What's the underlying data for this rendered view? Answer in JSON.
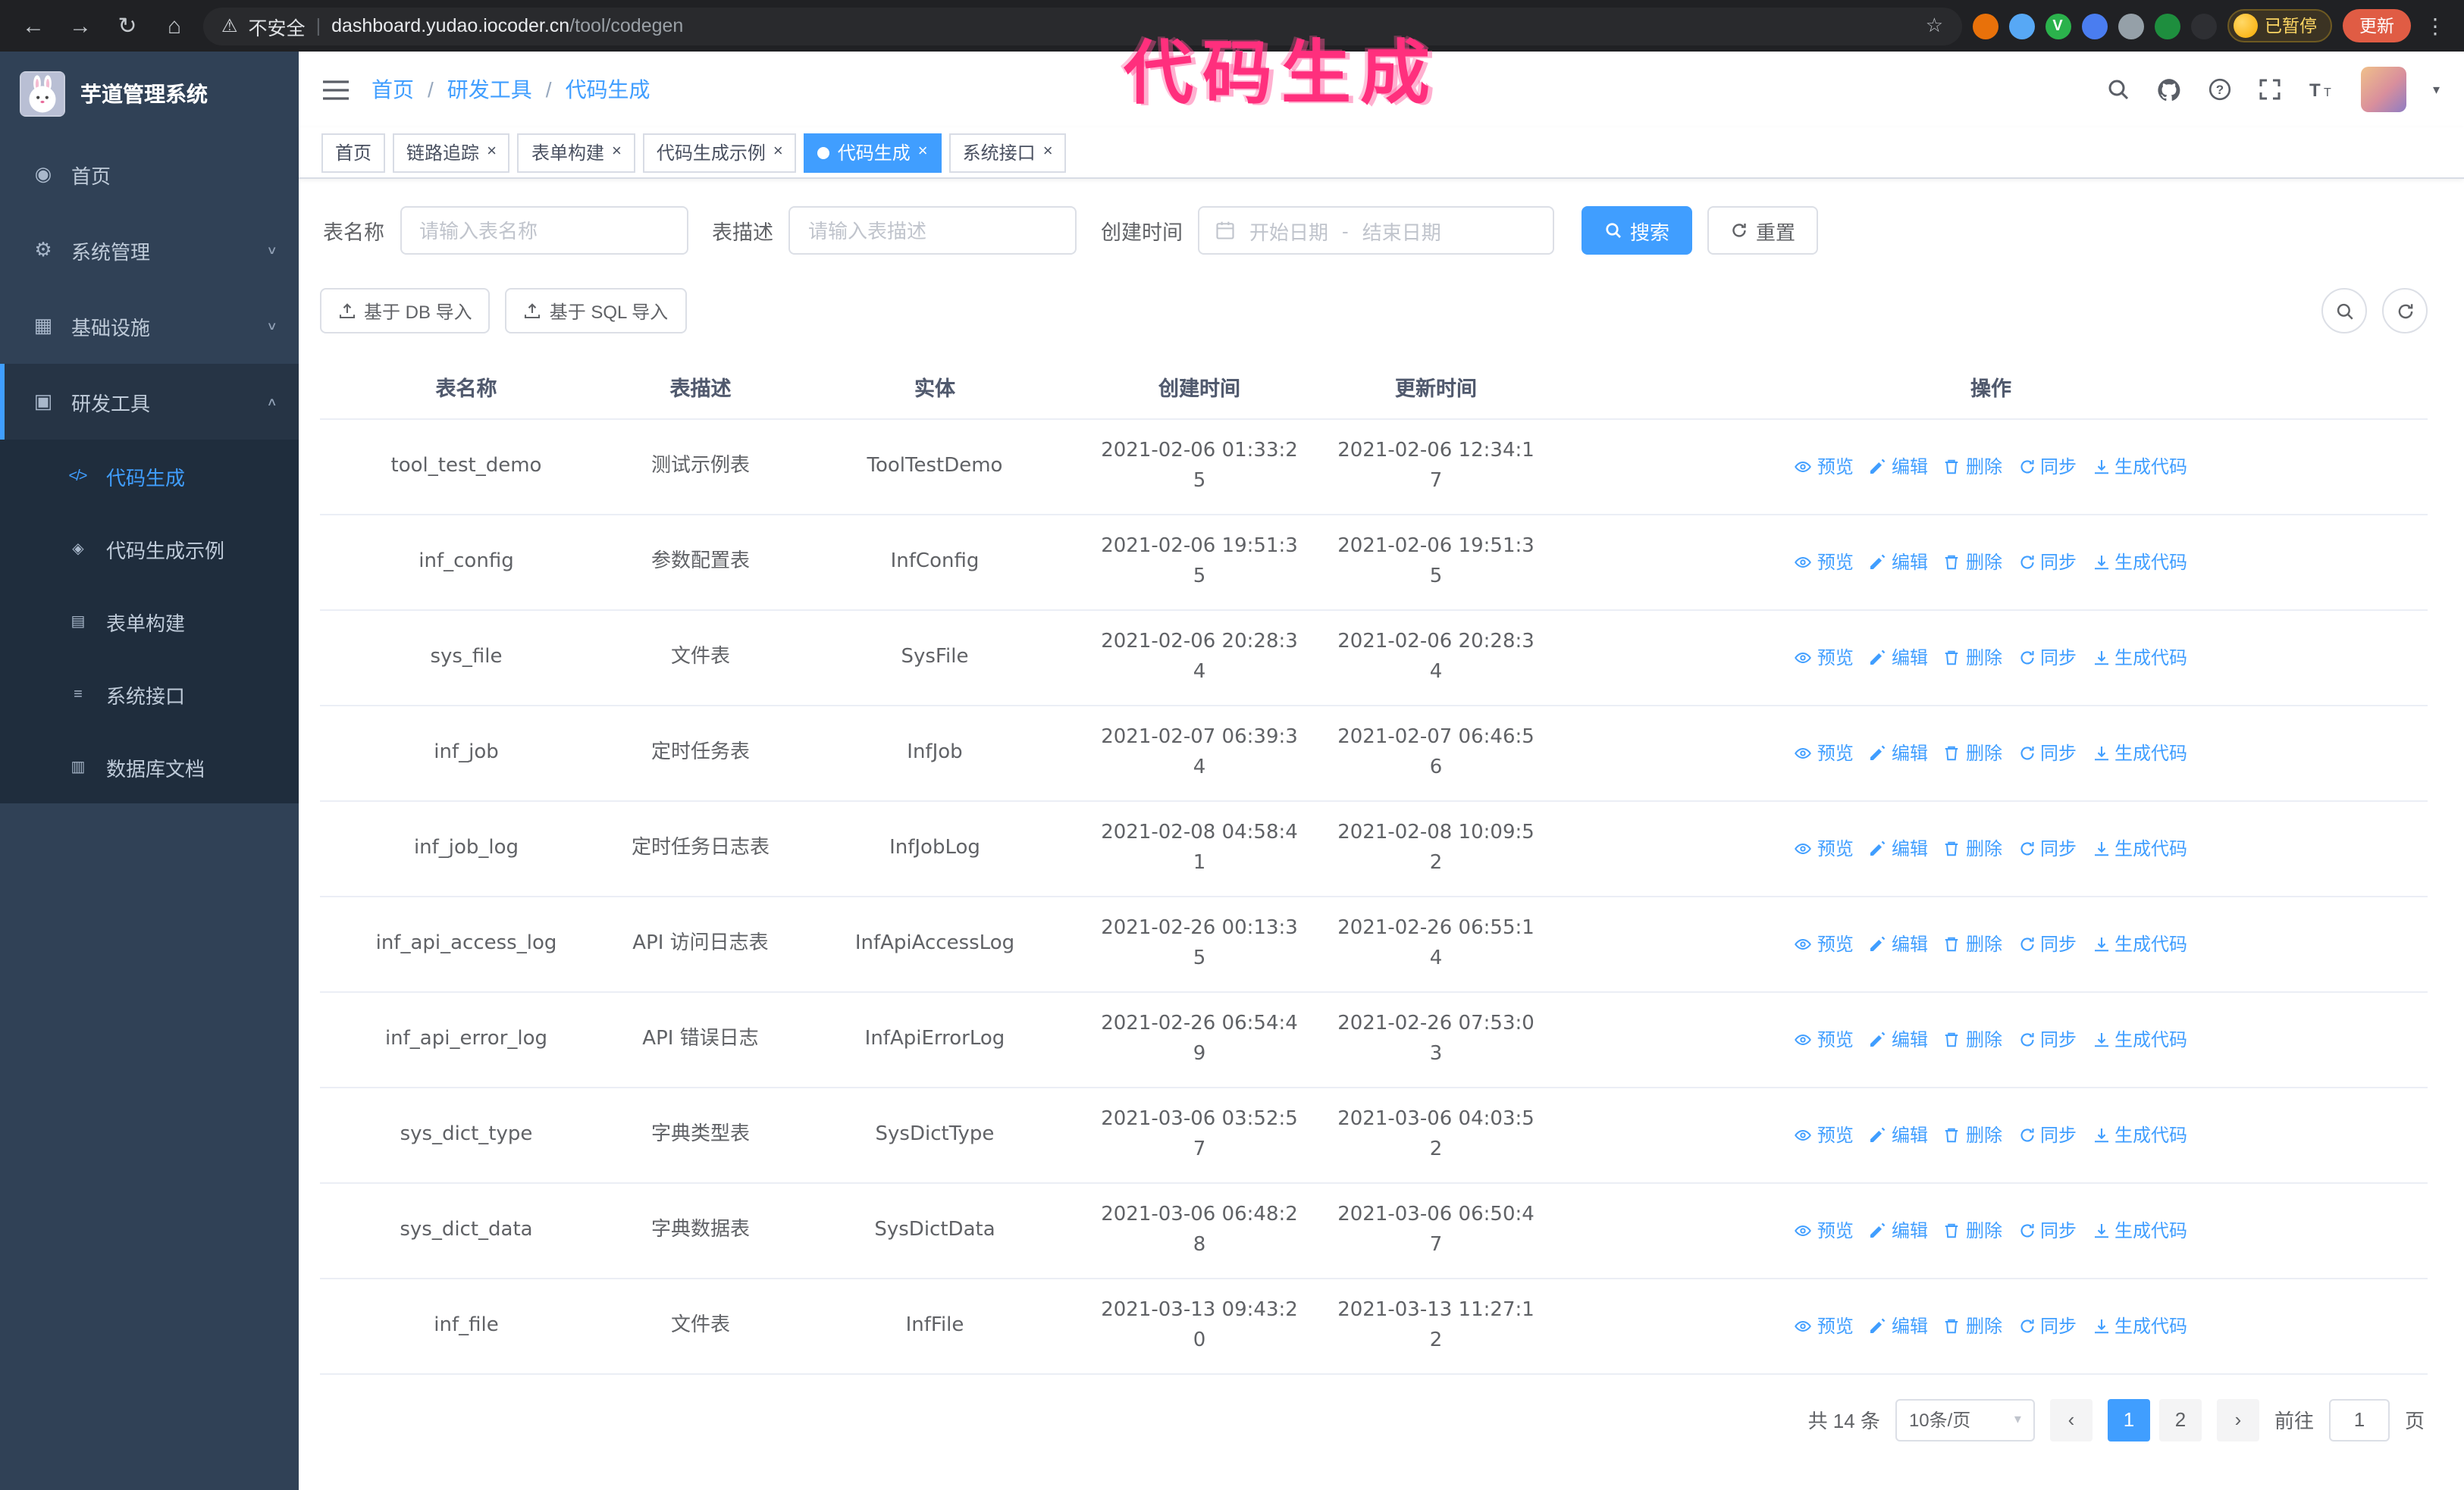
{
  "annotation": {
    "text": "代码生成"
  },
  "glyphs": {
    "back": "←",
    "forward": "→",
    "reload": "↻",
    "home": "⌂",
    "warning": "⚠",
    "divider": "|",
    "star": "☆",
    "kebab": "⋮",
    "close": "×",
    "caret_down": "▾",
    "crumb_sep": "/",
    "page_prev": "‹",
    "page_next": "›"
  },
  "browser": {
    "insecure_label": "不安全",
    "url_host": "dashboard.yudao.iocoder.cn",
    "url_path": "/tool/codegen",
    "extensions": [
      {
        "color": "#e8710a",
        "glyph": ""
      },
      {
        "color": "#57a8f5",
        "glyph": ""
      },
      {
        "color": "#2bb24c",
        "glyph": "V"
      },
      {
        "color": "#4a7df0",
        "glyph": ""
      },
      {
        "color": "#95a0a8",
        "glyph": ""
      },
      {
        "color": "#1e8e3e",
        "glyph": ""
      },
      {
        "color": "#2e2f33",
        "glyph": ""
      }
    ],
    "paused_badge": "已暂停",
    "update_button": "更新"
  },
  "sidebar": {
    "logo_title": "芋道管理系统",
    "items": [
      {
        "label": "首页",
        "glyph": "◉",
        "icon": "dashboard-icon",
        "chev": "",
        "open": false
      },
      {
        "label": "系统管理",
        "glyph": "⚙",
        "icon": "gear-icon",
        "chev": "∨",
        "open": false
      },
      {
        "label": "基础设施",
        "glyph": "▦",
        "icon": "infrastructure-icon",
        "chev": "∨",
        "open": false
      },
      {
        "label": "研发工具",
        "glyph": "▣",
        "icon": "dev-tools-icon",
        "chev": "∧",
        "open": true
      }
    ],
    "submenu": [
      {
        "label": "代码生成",
        "glyph": "</>",
        "icon": "code-icon",
        "active": true
      },
      {
        "label": "代码生成示例",
        "glyph": "◈",
        "icon": "code-example-icon",
        "active": false
      },
      {
        "label": "表单构建",
        "glyph": "▤",
        "icon": "form-builder-icon",
        "active": false
      },
      {
        "label": "系统接口",
        "glyph": "≡",
        "icon": "api-icon",
        "active": false
      },
      {
        "label": "数据库文档",
        "glyph": "▥",
        "icon": "database-doc-icon",
        "active": false
      }
    ]
  },
  "header": {
    "breadcrumb": [
      "首页",
      "研发工具",
      "代码生成"
    ]
  },
  "tabs": [
    {
      "label": "首页",
      "closable": false,
      "active": false
    },
    {
      "label": "链路追踪",
      "closable": true,
      "active": false
    },
    {
      "label": "表单构建",
      "closable": true,
      "active": false
    },
    {
      "label": "代码生成示例",
      "closable": true,
      "active": false
    },
    {
      "label": "代码生成",
      "closable": true,
      "active": true
    },
    {
      "label": "系统接口",
      "closable": true,
      "active": false
    }
  ],
  "filters": {
    "table_name_label": "表名称",
    "table_name_placeholder": "请输入表名称",
    "table_desc_label": "表描述",
    "table_desc_placeholder": "请输入表描述",
    "create_time_label": "创建时间",
    "date_start_placeholder": "开始日期",
    "date_sep": "-",
    "date_end_placeholder": "结束日期",
    "search_button": "搜索",
    "reset_button": "重置"
  },
  "toolbar": {
    "db_import": "基于 DB 导入",
    "sql_import": "基于 SQL 导入"
  },
  "table": {
    "columns": [
      "表名称",
      "表描述",
      "实体",
      "创建时间",
      "更新时间",
      "操作"
    ],
    "ops": [
      {
        "label": "预览"
      },
      {
        "label": "编辑"
      },
      {
        "label": "删除"
      },
      {
        "label": "同步"
      },
      {
        "label": "生成代码"
      }
    ],
    "rows": [
      {
        "name": "tool_test_demo",
        "desc": "测试示例表",
        "entity": "ToolTestDemo",
        "created": "2021-02-06 01:33:25",
        "updated": "2021-02-06 12:34:17"
      },
      {
        "name": "inf_config",
        "desc": "参数配置表",
        "entity": "InfConfig",
        "created": "2021-02-06 19:51:35",
        "updated": "2021-02-06 19:51:35"
      },
      {
        "name": "sys_file",
        "desc": "文件表",
        "entity": "SysFile",
        "created": "2021-02-06 20:28:34",
        "updated": "2021-02-06 20:28:34"
      },
      {
        "name": "inf_job",
        "desc": "定时任务表",
        "entity": "InfJob",
        "created": "2021-02-07 06:39:34",
        "updated": "2021-02-07 06:46:56"
      },
      {
        "name": "inf_job_log",
        "desc": "定时任务日志表",
        "entity": "InfJobLog",
        "created": "2021-02-08 04:58:41",
        "updated": "2021-02-08 10:09:52"
      },
      {
        "name": "inf_api_access_log",
        "desc": "API 访问日志表",
        "entity": "InfApiAccessLog",
        "created": "2021-02-26 00:13:35",
        "updated": "2021-02-26 06:55:14"
      },
      {
        "name": "inf_api_error_log",
        "desc": "API 错误日志",
        "entity": "InfApiErrorLog",
        "created": "2021-02-26 06:54:49",
        "updated": "2021-02-26 07:53:03"
      },
      {
        "name": "sys_dict_type",
        "desc": "字典类型表",
        "entity": "SysDictType",
        "created": "2021-03-06 03:52:57",
        "updated": "2021-03-06 04:03:52"
      },
      {
        "name": "sys_dict_data",
        "desc": "字典数据表",
        "entity": "SysDictData",
        "created": "2021-03-06 06:48:28",
        "updated": "2021-03-06 06:50:47"
      },
      {
        "name": "inf_file",
        "desc": "文件表",
        "entity": "InfFile",
        "created": "2021-03-13 09:43:20",
        "updated": "2021-03-13 11:27:12"
      }
    ]
  },
  "pagination": {
    "total": "共 14 条",
    "page_size": "10条/页",
    "pages": [
      {
        "label": "1",
        "active": true
      },
      {
        "label": "2",
        "active": false
      }
    ],
    "goto_label": "前往",
    "goto_value": "1",
    "goto_suffix": "页"
  }
}
